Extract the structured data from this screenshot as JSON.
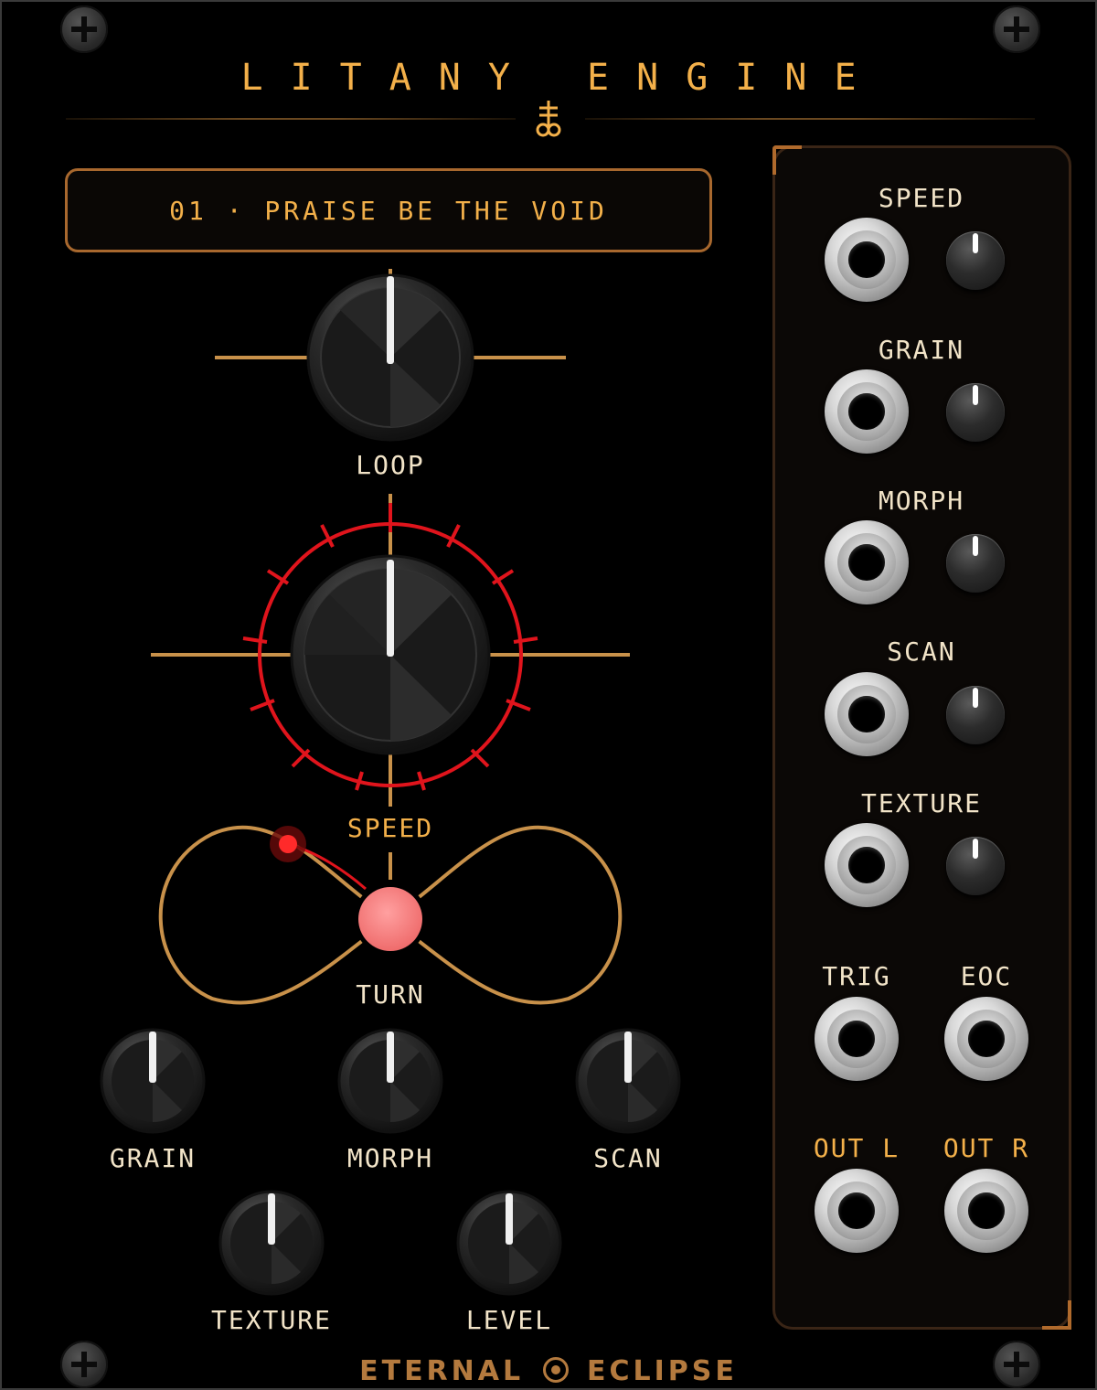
{
  "module": {
    "title": "LITANY ENGINE",
    "brand_left": "ETERNAL",
    "brand_right": "ECLIPSE"
  },
  "display": {
    "text": "01 · PRAISE BE THE VOID"
  },
  "knobs": {
    "loop": {
      "label": "LOOP"
    },
    "speed": {
      "label": "SPEED"
    },
    "turn": {
      "label": "TURN"
    },
    "grain": {
      "label": "GRAIN"
    },
    "morph": {
      "label": "MORPH"
    },
    "scan": {
      "label": "SCAN"
    },
    "texture": {
      "label": "TEXTURE"
    },
    "level": {
      "label": "LEVEL"
    }
  },
  "jacks": {
    "speed": {
      "label": "SPEED"
    },
    "grain": {
      "label": "GRAIN"
    },
    "morph": {
      "label": "MORPH"
    },
    "scan": {
      "label": "SCAN"
    },
    "texture": {
      "label": "TEXTURE"
    },
    "trig": {
      "label": "TRIG"
    },
    "eoc": {
      "label": "EOC"
    },
    "out_l": {
      "label": "OUT L"
    },
    "out_r": {
      "label": "OUT R"
    }
  },
  "colors": {
    "accent": "#f3b04a",
    "label": "#f2e4c8",
    "ring": "#e0141c",
    "trace": "#c8914a",
    "turn_button": "#f27a7a"
  }
}
